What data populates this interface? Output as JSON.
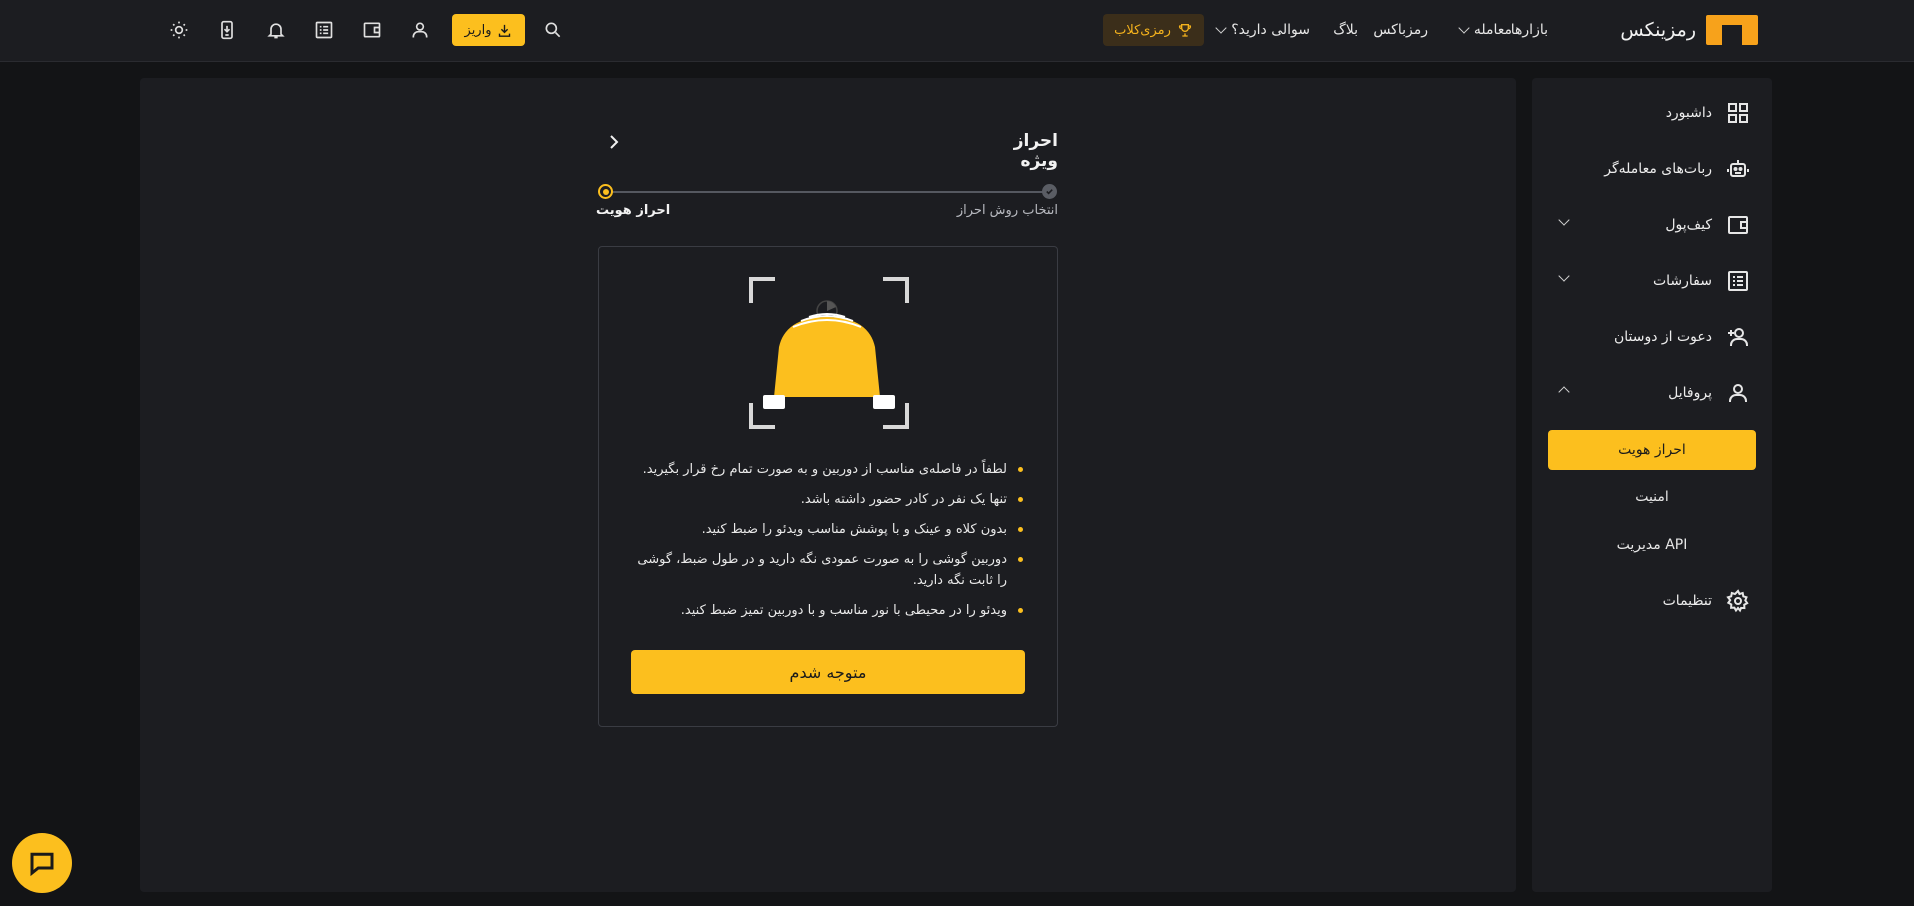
{
  "brand": {
    "logo_text": "رمزینکس",
    "accent": "#fcbf1e"
  },
  "header": {
    "nav": [
      {
        "label": "بازارها"
      },
      {
        "label": "معامله"
      },
      {
        "label": "رمزباکس"
      },
      {
        "label": "بلاگ"
      },
      {
        "label": "سوالی دارید؟"
      }
    ],
    "club_label": "رمزی‌کلاب",
    "deposit_label": "واریز"
  },
  "sidebar": {
    "items": [
      {
        "label": "داشبورد",
        "icon": "grid-icon"
      },
      {
        "label": "ربات‌های معامله‌گر",
        "icon": "robot-icon"
      },
      {
        "label": "کیف‌پول",
        "icon": "wallet-icon"
      },
      {
        "label": "سفارشات",
        "icon": "list-icon"
      },
      {
        "label": "دعوت از دوستان",
        "icon": "add-user-icon"
      },
      {
        "label": "پروفایل",
        "icon": "user-icon"
      },
      {
        "label": "تنظیمات",
        "icon": "gear-icon"
      }
    ],
    "profile_sub": [
      {
        "label": "احراز هویت"
      },
      {
        "label": "امنیت"
      },
      {
        "label": "مدیریت API"
      }
    ]
  },
  "main": {
    "title": "احراز ویژه",
    "steps": [
      {
        "label": "انتخاب روش احراز"
      },
      {
        "label": "احراز هویت"
      }
    ],
    "rules": [
      "لطفاً در فاصله‌ی مناسب از دوربین و به صورت تمام رخ قرار بگیرید.",
      "تنها یک نفر در کادر حضور داشته باشد.",
      "بدون کلاه و عینک و با پوشش مناسب ویدئو را ضبط کنید.",
      "دوربین گوشی را به صورت عمودی نگه دارید و در طول ضبط، گوشی را ثابت نگه دارید.",
      "ویدئو را در محیطی با نور مناسب و با دوربین تمیز ضبط کنید."
    ],
    "confirm_label": "متوجه شدم"
  }
}
